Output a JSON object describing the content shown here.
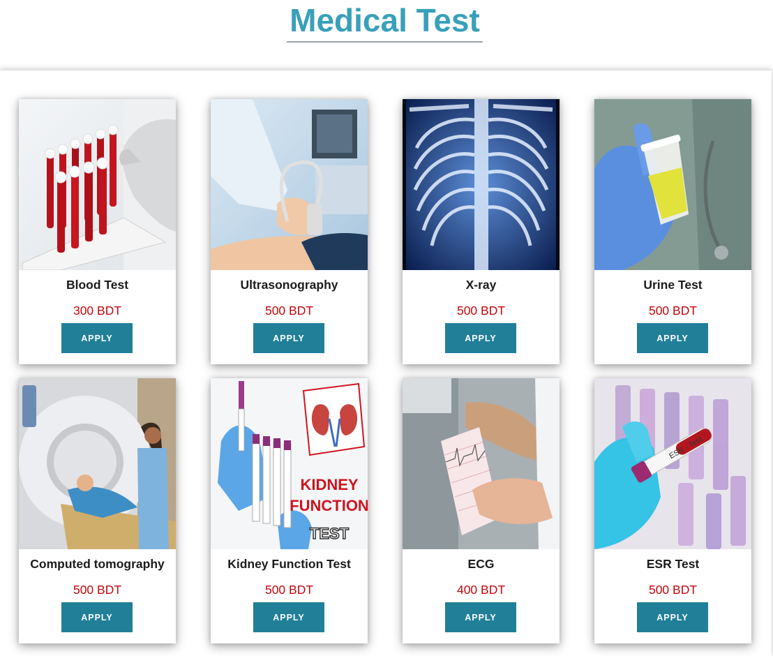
{
  "page": {
    "title": "Medical Test"
  },
  "colors": {
    "title": "#39a0b9",
    "price": "#c0070d",
    "button": "#217f98"
  },
  "tests": [
    {
      "name": "Blood Test",
      "price": "300 BDT",
      "button": "APPLY",
      "image": "blood-test-tubes-photo"
    },
    {
      "name": "Ultrasonography",
      "price": "500 BDT",
      "button": "APPLY",
      "image": "ultrasound-probe-photo"
    },
    {
      "name": "X-ray",
      "price": "500 BDT",
      "button": "APPLY",
      "image": "chest-xray-photo"
    },
    {
      "name": "Urine Test",
      "price": "500 BDT",
      "button": "APPLY",
      "image": "urine-sample-cup-photo"
    },
    {
      "name": "Computed tomography",
      "price": "500 BDT",
      "button": "APPLY",
      "image": "ct-scanner-photo"
    },
    {
      "name": "Kidney Function Test",
      "price": "500 BDT",
      "button": "APPLY",
      "image": "kidney-function-test-photo",
      "image_text": [
        "KIDNEY",
        "FUNCTION",
        "TEST"
      ]
    },
    {
      "name": "ECG",
      "price": "400 BDT",
      "button": "APPLY",
      "image": "ecg-printout-photo"
    },
    {
      "name": "ESR Test",
      "price": "500 BDT",
      "button": "APPLY",
      "image": "esr-test-tube-photo",
      "image_text": [
        "ESR - Test"
      ]
    }
  ]
}
